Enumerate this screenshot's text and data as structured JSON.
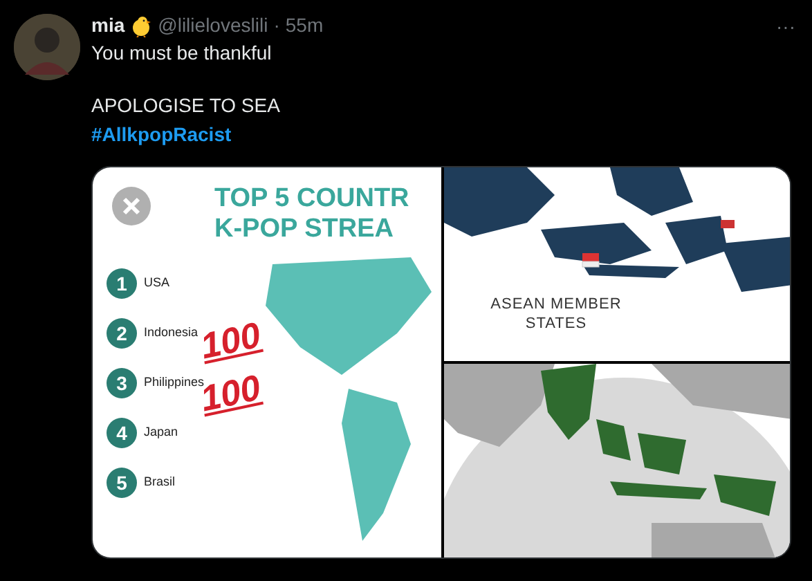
{
  "tweet": {
    "name": "mia",
    "handle": "@lilieloveslili",
    "separator": "·",
    "time": "55m",
    "more": "···",
    "lines": [
      "You must be thankful",
      "APOLOGISE TO SEA"
    ],
    "hashtag": "#AllkpopRacist"
  },
  "media": {
    "infographic": {
      "title_lines": [
        "TOP 5 COUNTR",
        "K-POP STREA"
      ],
      "ranks": [
        {
          "number": "1",
          "country": "USA"
        },
        {
          "number": "2",
          "country": "Indonesia"
        },
        {
          "number": "3",
          "country": "Philippines"
        },
        {
          "number": "4",
          "country": "Japan"
        },
        {
          "number": "5",
          "country": "Brasil"
        }
      ],
      "stamps": [
        "100",
        "100"
      ]
    },
    "map_label": "ASEAN MEMBER STATES"
  }
}
